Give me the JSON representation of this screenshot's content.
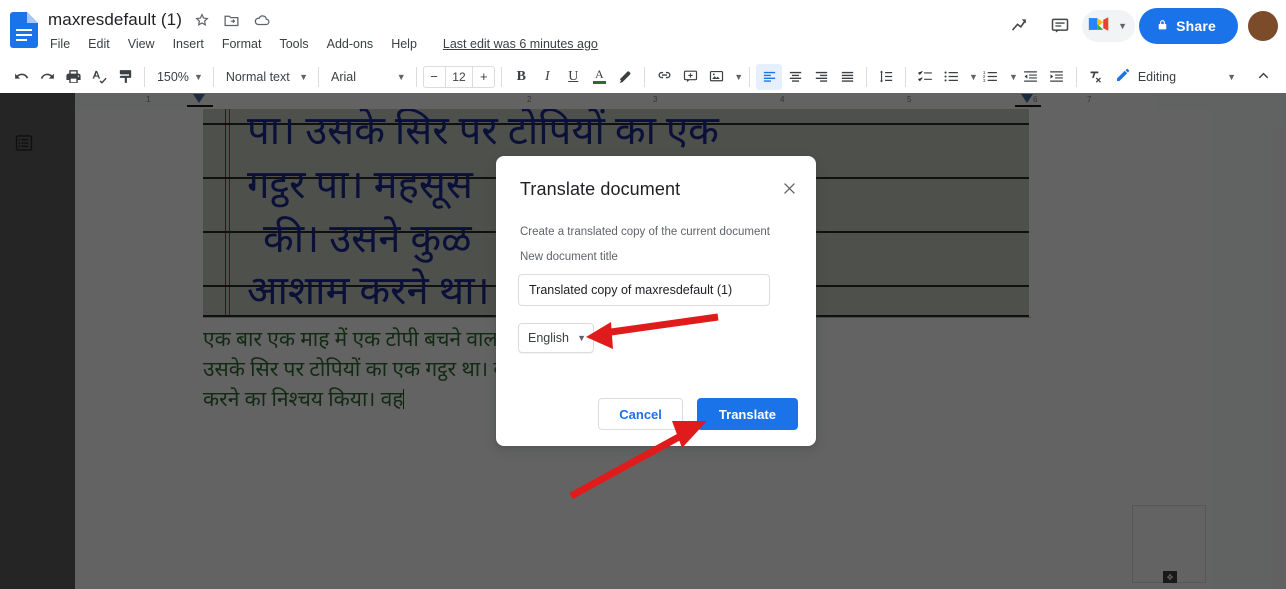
{
  "app": {
    "name": "Google Docs",
    "logo_icon": "docs-file-icon",
    "document_title": "maxresdefault (1)",
    "title_icons": [
      "star-icon",
      "move-to-folder-icon",
      "cloud-saved-icon"
    ],
    "menus": [
      "File",
      "Edit",
      "View",
      "Insert",
      "Format",
      "Tools",
      "Add-ons",
      "Help"
    ],
    "last_edit": "Last edit was 6 minutes ago",
    "right_actions": [
      {
        "icon": "activity-trending-icon",
        "label": ""
      },
      {
        "icon": "comment-history-icon",
        "label": ""
      }
    ],
    "meet_chip": {
      "icon": "google-meet-icon",
      "caret": "chevron-down-icon"
    },
    "share_button": {
      "icon": "lock-icon",
      "label": "Share"
    },
    "avatar": {
      "name": "avatar",
      "initial": ""
    }
  },
  "toolbar": {
    "undo_icon": "undo-icon",
    "redo_icon": "redo-icon",
    "print_icon": "print-icon",
    "spellcheck_icon": "spellcheck-icon",
    "paint_format_icon": "paint-format-icon",
    "zoom": "150%",
    "paragraph_style": "Normal text",
    "font": "Arial",
    "font_size": "12",
    "font_size_decrease": "−",
    "font_size_increase": "+",
    "bold": "B",
    "italic": "I",
    "underline": "U",
    "text_color": "A",
    "text_color_value": "#2f6a34",
    "highlight_icon": "highlight-pen-icon",
    "link_icon": "insert-link-icon",
    "comment_icon": "add-comment-icon",
    "image_icon": "insert-image-icon",
    "align_left_icon": "align-left-icon",
    "align_center_icon": "align-center-icon",
    "align_right_icon": "align-right-icon",
    "align_justify_icon": "align-justify-icon",
    "line_spacing_icon": "line-spacing-icon",
    "checklist_icon": "checklist-icon",
    "bulleted_list_icon": "bulleted-list-icon",
    "numbered_list_icon": "numbered-list-icon",
    "decrease_indent_icon": "decrease-indent-icon",
    "increase_indent_icon": "increase-indent-icon",
    "clear_formatting_icon": "clear-formatting-icon",
    "mode": {
      "icon": "pencil-icon",
      "label": "Editing",
      "caret": "chevron-down-icon"
    },
    "collapse_icon": "chevron-up-icon",
    "accent_color": "#1a73e8"
  },
  "document": {
    "outline_icon": "document-outline-icon",
    "ruler": {
      "numbers": [
        "1",
        "2",
        "3",
        "4",
        "5",
        "6",
        "7"
      ],
      "left_indent_marker": "left-indent-marker",
      "right_indent_marker": "right-indent-marker"
    },
    "handwritten_image": {
      "name": "handwritten-hindi-scan",
      "lines": [
        "पा।  उसके   सिर  पर  टोपियों  का  एक",
        "गट्ठर   पा।                    महसूस",
        "की।  उसने                          कुळ",
        "आशाम   करने                 था। वह"
      ]
    },
    "green_text": [
      "एक बार एक माह में एक टोपी बचने वाला होकर एक गाँव जा रहा प्याा",
      "उसके सिर पर टोपियों का एक गट्ठर था। वह पेड़ के नीचे कुळ आशाम",
      "करने का निश्चय किया। वह"
    ],
    "green_text_color": "#2f6a34",
    "explore_panel": {
      "name": "floating-panel",
      "nub_icon": "resize-handle-icon"
    }
  },
  "dialog": {
    "title": "Translate document",
    "close_icon": "close-icon",
    "subtitle": "Create a translated copy of the current document",
    "field_label": "New document title",
    "title_input": {
      "value": "Translated copy of maxresdefault (1)",
      "placeholder": "New document title"
    },
    "language_select": {
      "value": "English",
      "caret": "chevron-down-icon"
    },
    "cancel_button": "Cancel",
    "translate_button": "Translate",
    "primary_color": "#1a73e8"
  },
  "annotations": {
    "arrow_color": "#e01b1b",
    "arrows": [
      {
        "name": "arrow-to-language-select",
        "points_to": "language-select"
      },
      {
        "name": "arrow-to-translate-button",
        "points_to": "translate-button"
      }
    ]
  }
}
